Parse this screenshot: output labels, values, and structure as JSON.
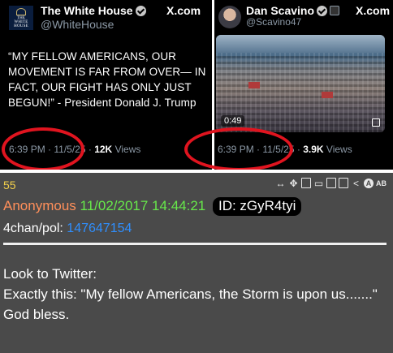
{
  "left_tweet": {
    "account_name": "The White House",
    "handle": "@WhiteHouse",
    "site": "X.com",
    "avatar_text": [
      "THE",
      "WHITE",
      "HOUSE"
    ],
    "quote": "“MY FELLOW AMERICANS, OUR MOVEMENT IS FAR FROM OVER— IN FACT, OUR FIGHT HAS ONLY JUST BEGUN!” - President Donald J. Trump",
    "time": "6:39 PM",
    "date": "11/5/25",
    "views_count": "12K",
    "views_label": "Views"
  },
  "right_tweet": {
    "account_name": "Dan Scavino",
    "handle": "@Scavino47",
    "site": "X.com",
    "video_duration": "0:49",
    "time": "6:39 PM",
    "date": "11/5/25",
    "views_count": "3.9K",
    "views_label": "Views"
  },
  "separator": " · ",
  "colors": {
    "highlight_circle": "#e0141f",
    "post_background": "#4a4a4a",
    "post_number": "#f2d04a",
    "anon_name": "#ff8f5a",
    "timestamp": "#67e84a",
    "link": "#2f8fff"
  },
  "post": {
    "number": "55",
    "author": "Anonymous",
    "datetime": "11/02/2017 14:44:21",
    "id_label": "ID: zGyR4tyi",
    "board": "4chan/pol:",
    "thread_link": "147647154",
    "body_lines": [
      "Look to Twitter:",
      "Exactly this: \"My fellow Americans, the Storm is upon us.......\"",
      "God bless."
    ],
    "toolbar_icons": [
      "resize-arrows-icon",
      "move-icon",
      "document-icon",
      "vr-goggles-icon",
      "clipboard-icon",
      "clipboard-check-icon",
      "share-icon",
      "a-circle-icon",
      "ab-check-icon"
    ]
  }
}
